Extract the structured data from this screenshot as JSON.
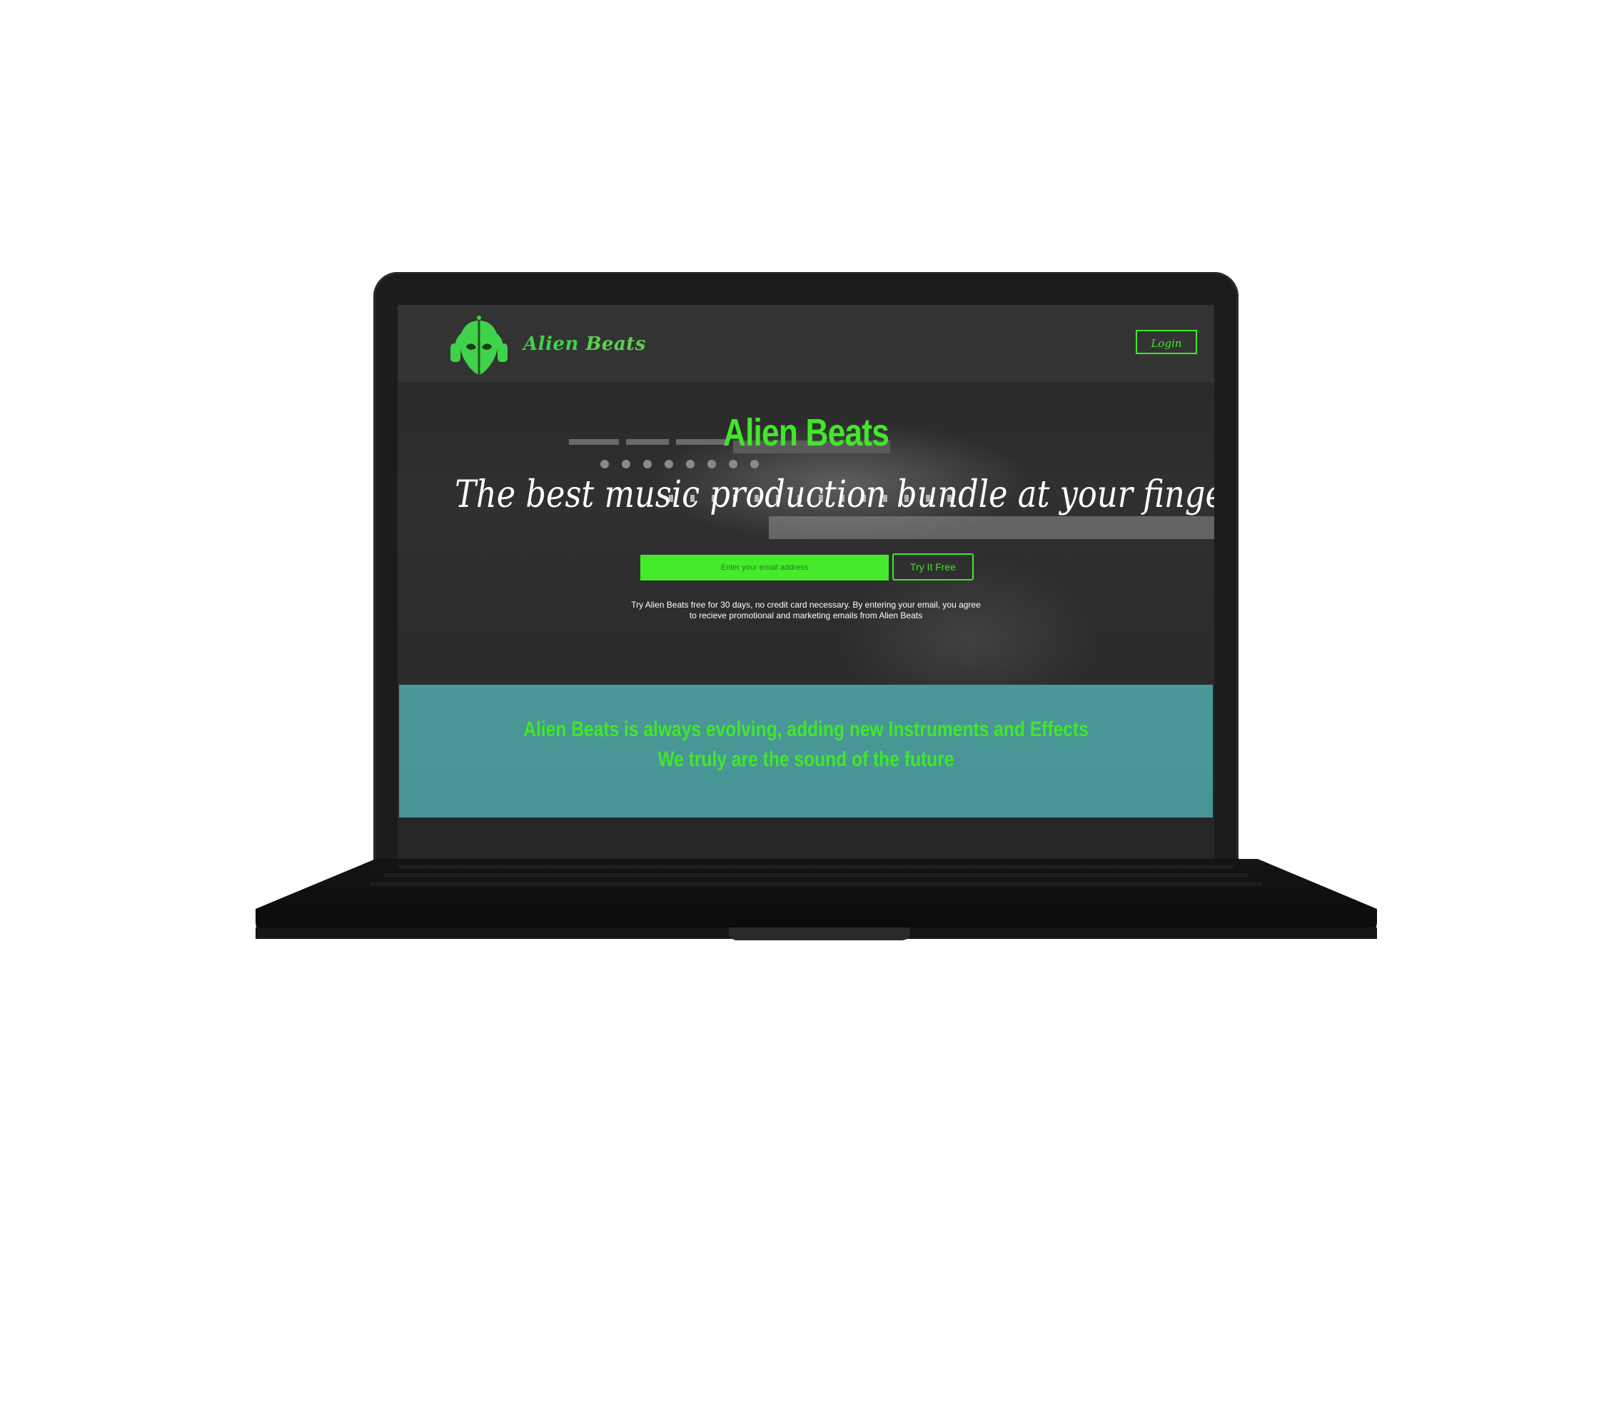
{
  "nav": {
    "brand_alien": "Alien",
    "brand_beats": "Beats",
    "login_label": "Login",
    "logo_icon": "alien-headphones-logo-icon"
  },
  "hero": {
    "title": "Alien Beats",
    "subtitle": "The best music production bundle at your fingertips",
    "email_placeholder": "Enter your email address",
    "cta_label": "Try It Free",
    "disclaimer_line1": "Try Alien Beats free for 30 days, no credit card necessary. By entering your email, you agree",
    "disclaimer_line2": "to recieve promotional and marketing emails from Alien Beats"
  },
  "band": {
    "line1": "Alien Beats is always evolving, adding new Instruments and Effects",
    "line2": "We truly are the sound of the future"
  },
  "colors": {
    "accent_green": "#42e62a",
    "teal_band": "#4a9898",
    "nav_bg": "#333333",
    "laptop_body": "#1c1c1c"
  }
}
